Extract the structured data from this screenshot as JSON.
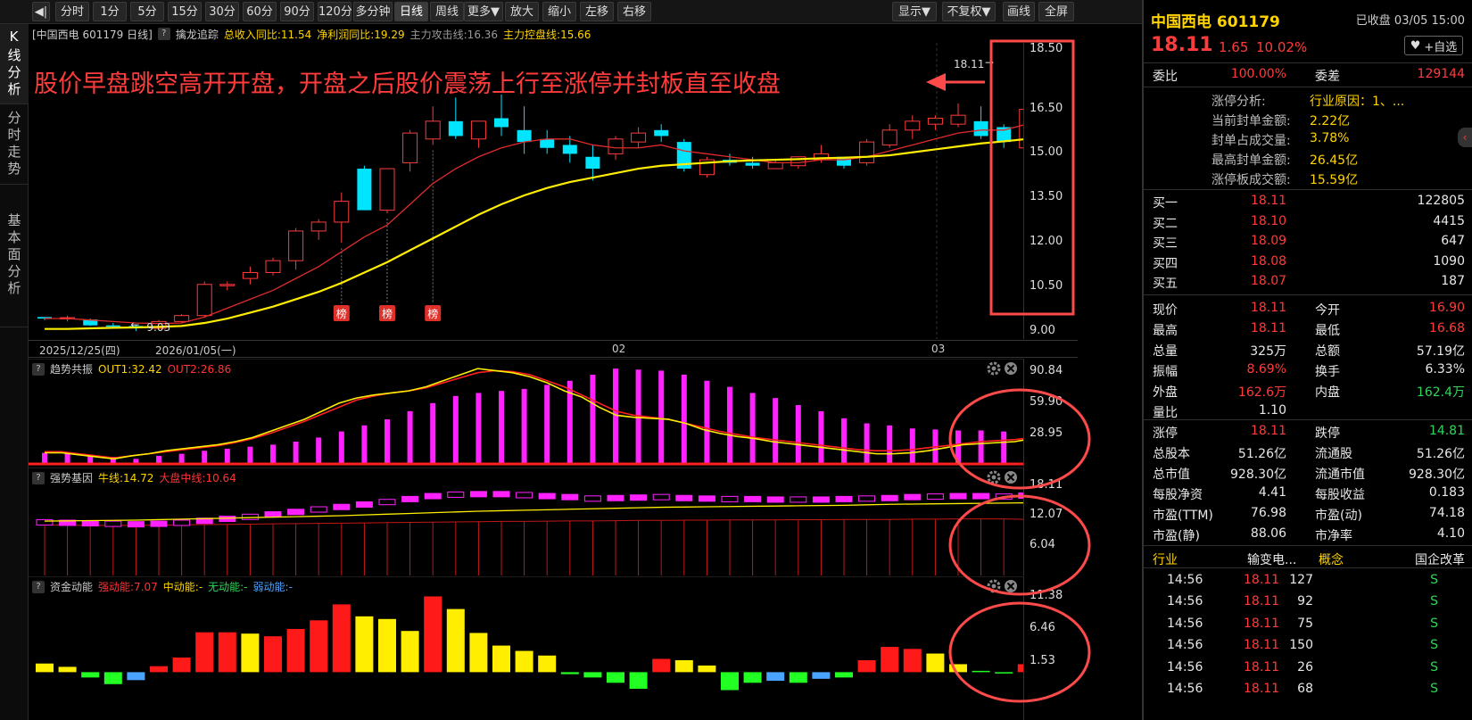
{
  "toolbar": {
    "buttons": [
      "◀|",
      "分时",
      "1分",
      "5分",
      "15分",
      "30分",
      "60分",
      "90分",
      "120分",
      "多分钟",
      "日线",
      "周线",
      "更多▼",
      "放大",
      "缩小",
      "左移",
      "右移"
    ],
    "active": "日线",
    "right_buttons": [
      "显示▼",
      "不复权▼",
      "画线",
      "全屏"
    ]
  },
  "leftnav": {
    "tabs": [
      "K线分析",
      "分时走势",
      "基本面分析"
    ]
  },
  "main_header": {
    "title": "[中国西电 601179 日线]",
    "indicator": "擒龙追踪",
    "items": [
      {
        "text": "总收入同比:11.54",
        "color": "#ffd400"
      },
      {
        "text": "净利润同比:19.29",
        "color": "#ffd400"
      },
      {
        "text": "主力攻击线:16.36",
        "color": "#9a9a9a"
      },
      {
        "text": "主力控盘线:15.66",
        "color": "#ffd400"
      }
    ]
  },
  "annotation": {
    "text": "股价早盘跳空高开开盘，开盘之后股价震荡上行至涨停并封板直至收盘",
    "last_price_label": "18.11",
    "low_label": "9.03",
    "bang_label": "榜"
  },
  "price_axis": [
    "18.50",
    "16.50",
    "15.00",
    "13.50",
    "12.00",
    "10.50",
    "9.00"
  ],
  "dates": [
    "2025/12/25(四)",
    "2026/01/05(一)",
    "02",
    "03"
  ],
  "ind1": {
    "name": "趋势共振",
    "items": [
      {
        "text": "OUT1:32.42",
        "color": "#ffd400"
      },
      {
        "text": "OUT2:26.86",
        "color": "#ff3333"
      }
    ],
    "axis": [
      "90.84",
      "59.90",
      "28.95"
    ]
  },
  "ind2": {
    "name": "强势基因",
    "items": [
      {
        "text": "牛线:14.72",
        "color": "#ffd400"
      },
      {
        "text": "大盘中线:10.64",
        "color": "#ff3333"
      }
    ],
    "axis": [
      "18.11",
      "12.07",
      "6.04"
    ]
  },
  "ind3": {
    "name": "资金动能",
    "items": [
      {
        "text": "强动能:7.07",
        "color": "#ff3333"
      },
      {
        "text": "中动能:-",
        "color": "#ffd400"
      },
      {
        "text": "无动能:-",
        "color": "#2fd65a"
      },
      {
        "text": "弱动能:-",
        "color": "#4aa3ff"
      }
    ],
    "axis": [
      "11.38",
      "6.46",
      "1.53"
    ]
  },
  "chart_data": {
    "type": "candlestick",
    "dates_shown": [
      "2025/12/25(四)",
      "2026/01/05(一)",
      "02",
      "03"
    ],
    "ohlc": [
      [
        9.5,
        9.5,
        9.4,
        9.45
      ],
      [
        9.45,
        9.55,
        9.35,
        9.48
      ],
      [
        9.42,
        9.45,
        9.2,
        9.22
      ],
      [
        9.22,
        9.3,
        9.13,
        9.2
      ],
      [
        9.2,
        9.25,
        9.03,
        9.12
      ],
      [
        9.12,
        9.4,
        9.1,
        9.35
      ],
      [
        9.35,
        9.6,
        9.3,
        9.55
      ],
      [
        9.55,
        10.7,
        9.5,
        10.6
      ],
      [
        10.6,
        10.7,
        10.4,
        10.6
      ],
      [
        10.8,
        11.2,
        10.6,
        11.0
      ],
      [
        11.0,
        11.5,
        10.9,
        11.4
      ],
      [
        11.4,
        12.5,
        11.1,
        12.4
      ],
      [
        12.4,
        12.8,
        12.1,
        12.7
      ],
      [
        12.7,
        13.7,
        12.0,
        13.4
      ],
      [
        14.5,
        14.6,
        13.1,
        13.1
      ],
      [
        13.1,
        14.5,
        13.0,
        14.5
      ],
      [
        14.7,
        15.8,
        14.4,
        15.7
      ],
      [
        15.5,
        16.6,
        15.3,
        16.1
      ],
      [
        16.1,
        16.9,
        15.5,
        15.6
      ],
      [
        15.5,
        16.0,
        15.2,
        16.1
      ],
      [
        16.2,
        17.0,
        15.6,
        15.9
      ],
      [
        15.8,
        16.6,
        15.0,
        15.4
      ],
      [
        15.5,
        15.8,
        15.0,
        15.2
      ],
      [
        15.3,
        15.6,
        14.7,
        15.0
      ],
      [
        14.9,
        15.3,
        14.1,
        14.5
      ],
      [
        15.0,
        15.6,
        14.8,
        15.5
      ],
      [
        15.4,
        15.9,
        15.2,
        15.7
      ],
      [
        15.8,
        16.0,
        15.4,
        15.6
      ],
      [
        15.4,
        15.5,
        14.4,
        14.5
      ],
      [
        14.3,
        14.9,
        14.2,
        14.8
      ],
      [
        14.8,
        15.0,
        14.6,
        14.7
      ],
      [
        14.7,
        14.9,
        14.5,
        14.6
      ],
      [
        14.5,
        14.8,
        14.5,
        14.7
      ],
      [
        14.6,
        14.8,
        14.5,
        14.9
      ],
      [
        14.8,
        15.3,
        14.7,
        15.0
      ],
      [
        14.9,
        14.9,
        14.5,
        14.6
      ],
      [
        14.7,
        15.5,
        14.6,
        15.4
      ],
      [
        15.3,
        16.0,
        15.2,
        15.8
      ],
      [
        15.8,
        16.3,
        15.5,
        16.1
      ],
      [
        16.0,
        16.3,
        15.8,
        16.2
      ],
      [
        16.0,
        16.7,
        15.9,
        16.3
      ],
      [
        16.1,
        16.6,
        15.5,
        15.6
      ],
      [
        15.9,
        16.0,
        15.2,
        15.4
      ],
      [
        15.2,
        16.5,
        15.2,
        16.5
      ],
      [
        16.9,
        18.11,
        16.68,
        18.11
      ]
    ],
    "ma_red": [
      9.45,
      9.45,
      9.4,
      9.35,
      9.3,
      9.28,
      9.3,
      9.5,
      9.8,
      10.1,
      10.4,
      10.8,
      11.2,
      11.7,
      12.2,
      12.6,
      13.3,
      14.0,
      14.5,
      14.9,
      15.2,
      15.4,
      15.5,
      15.5,
      15.3,
      15.2,
      15.2,
      15.3,
      15.1,
      15.0,
      14.9,
      14.8,
      14.7,
      14.7,
      14.8,
      14.8,
      14.9,
      15.1,
      15.3,
      15.5,
      15.7,
      15.8,
      15.8,
      16.0,
      16.36
    ],
    "ma_yellow": [
      9.1,
      9.1,
      9.12,
      9.14,
      9.15,
      9.17,
      9.2,
      9.3,
      9.45,
      9.65,
      9.85,
      10.1,
      10.35,
      10.65,
      11.0,
      11.35,
      11.75,
      12.15,
      12.55,
      12.95,
      13.3,
      13.6,
      13.85,
      14.05,
      14.2,
      14.35,
      14.5,
      14.6,
      14.65,
      14.7,
      14.75,
      14.78,
      14.8,
      14.82,
      14.85,
      14.87,
      14.9,
      14.95,
      15.05,
      15.15,
      15.25,
      15.35,
      15.42,
      15.5,
      15.66
    ],
    "ylim": [
      9.0,
      18.5
    ],
    "indicator1": {
      "ylim": [
        0,
        95
      ],
      "bars": [
        11,
        11,
        9,
        7,
        5,
        8,
        10,
        13,
        15,
        17,
        19,
        22,
        26,
        32,
        38,
        44,
        52,
        60,
        67,
        70,
        72,
        74,
        78,
        82,
        88,
        94,
        93,
        92,
        88,
        82,
        76,
        70,
        65,
        58,
        52,
        45,
        40,
        38,
        35,
        34,
        33,
        33,
        32,
        32,
        30
      ],
      "out1": [
        11,
        11,
        9,
        7,
        5,
        8,
        10,
        13,
        15,
        17,
        19,
        22,
        26,
        32,
        38,
        44,
        52,
        60,
        65,
        68,
        70,
        72,
        76,
        82,
        88,
        94,
        92,
        90,
        86,
        80,
        72,
        66,
        56,
        48,
        46,
        45,
        44,
        40,
        34,
        30,
        27,
        25,
        22,
        20,
        18,
        16,
        14,
        12,
        10,
        10,
        11,
        13,
        16,
        19,
        20,
        21,
        22,
        25,
        32.42
      ],
      "out2": [
        12,
        12,
        10,
        8,
        6,
        8,
        10,
        12,
        14,
        16,
        18,
        21,
        25,
        30,
        36,
        42,
        49,
        56,
        63,
        67,
        70,
        72,
        75,
        80,
        85,
        90,
        92,
        91,
        88,
        82,
        76,
        68,
        60,
        52,
        48,
        46,
        44,
        40,
        36,
        32,
        29,
        26,
        24,
        22,
        20,
        18,
        16,
        14,
        13,
        13,
        14,
        16,
        18,
        20,
        22,
        23,
        24,
        26,
        26.86
      ]
    },
    "indicator2": {
      "ylim": [
        0,
        19.5
      ],
      "bars": [
        11.3,
        11.2,
        11.1,
        11.0,
        10.9,
        11.0,
        11.2,
        11.6,
        12.0,
        12.4,
        12.9,
        13.4,
        13.9,
        14.4,
        14.9,
        15.4,
        16.0,
        16.6,
        16.9,
        17.0,
        17.0,
        16.8,
        16.6,
        16.4,
        16.1,
        16.2,
        16.3,
        16.4,
        16.2,
        16.1,
        16.0,
        16.0,
        15.9,
        15.9,
        15.9,
        16.0,
        16.1,
        16.2,
        16.4,
        16.5,
        16.6,
        16.6,
        16.5,
        16.7,
        18.11
      ],
      "bull": [
        11.0,
        11.05,
        11.1,
        11.15,
        11.2,
        11.3,
        11.4,
        11.5,
        11.6,
        11.7,
        11.8,
        11.9,
        12.0,
        12.1,
        12.25,
        12.4,
        12.55,
        12.7,
        12.85,
        13.0,
        13.1,
        13.2,
        13.3,
        13.4,
        13.5,
        13.6,
        13.7,
        13.8,
        13.85,
        13.9,
        13.95,
        14.0,
        14.05,
        14.1,
        14.15,
        14.2,
        14.3,
        14.4,
        14.45,
        14.5,
        14.55,
        14.6,
        14.65,
        14.7,
        14.72
      ],
      "mid": [
        10.6,
        10.55,
        10.5,
        10.5,
        10.5,
        10.55,
        10.6,
        10.65,
        10.7,
        10.75,
        10.8,
        10.85,
        10.9,
        10.95,
        11.0,
        11.05,
        11.1,
        11.15,
        11.2,
        11.25,
        11.3,
        11.3,
        11.35,
        11.4,
        11.4,
        11.45,
        11.5,
        11.5,
        11.55,
        11.55,
        11.6,
        11.6,
        11.6,
        11.65,
        11.65,
        11.7,
        11.7,
        11.7,
        11.75,
        11.75,
        11.8,
        11.8,
        11.8,
        11.7,
        10.64
      ]
    },
    "indicator3": {
      "ylim": [
        -2.5,
        12
      ],
      "values": [
        1.3,
        0.8,
        -0.8,
        -1.8,
        -1.2,
        0.9,
        2.2,
        6.0,
        6.0,
        5.8,
        5.4,
        6.5,
        7.8,
        10.2,
        8.4,
        8.0,
        6.2,
        11.4,
        9.5,
        5.9,
        4.0,
        3.2,
        2.5,
        -0.3,
        -0.8,
        -1.6,
        -2.5,
        2.0,
        1.8,
        1.0,
        -2.7,
        -1.6,
        -1.3,
        -1.6,
        -1.0,
        -0.8,
        1.8,
        3.8,
        3.5,
        2.8,
        1.2,
        0.2,
        -0.1,
        1.2,
        7.07
      ],
      "colors": [
        "yellow",
        "yellow",
        "green",
        "green",
        "blue",
        "red",
        "red",
        "red",
        "red",
        "yellow",
        "red",
        "red",
        "red",
        "red",
        "yellow",
        "yellow",
        "yellow",
        "red",
        "yellow",
        "yellow",
        "yellow",
        "yellow",
        "yellow",
        "green",
        "green",
        "green",
        "green",
        "red",
        "yellow",
        "yellow",
        "green",
        "green",
        "blue",
        "green",
        "blue",
        "green",
        "red",
        "red",
        "red",
        "yellow",
        "yellow",
        "green",
        "green",
        "red",
        "red"
      ]
    }
  },
  "rpanel": {
    "stock": "中国西电 601179",
    "status": "已收盘 03/05 15:00",
    "price": "18.11",
    "change": "1.65",
    "pct": "10.02%",
    "watch": "+自选",
    "webi_label": "委比",
    "webi": "100.00%",
    "weicha_label": "委差",
    "weicha": "129144",
    "limit": [
      {
        "label": "涨停分析:",
        "value": "行业原因：1、..."
      },
      {
        "label": "当前封单金额:",
        "value": "2.22亿"
      },
      {
        "label": "封单占成交量:",
        "value": "3.78%"
      },
      {
        "label": "最高封单金额:",
        "value": "26.45亿"
      },
      {
        "label": "涨停板成交额:",
        "value": "15.59亿"
      }
    ],
    "bids": [
      {
        "label": "买一",
        "price": "18.11",
        "vol": "122805"
      },
      {
        "label": "买二",
        "price": "18.10",
        "vol": "4415"
      },
      {
        "label": "买三",
        "price": "18.09",
        "vol": "647"
      },
      {
        "label": "买四",
        "price": "18.08",
        "vol": "1090"
      },
      {
        "label": "买五",
        "price": "18.07",
        "vol": "187"
      }
    ],
    "stats": [
      [
        {
          "l": "现价",
          "v": "18.11",
          "c": "red"
        },
        {
          "l": "今开",
          "v": "16.90",
          "c": "red"
        }
      ],
      [
        {
          "l": "最高",
          "v": "18.11",
          "c": "red"
        },
        {
          "l": "最低",
          "v": "16.68",
          "c": "red"
        }
      ],
      [
        {
          "l": "总量",
          "v": "325万",
          "c": "white"
        },
        {
          "l": "总额",
          "v": "57.19亿",
          "c": "white"
        }
      ],
      [
        {
          "l": "振幅",
          "v": "8.69%",
          "c": "red"
        },
        {
          "l": "换手",
          "v": "6.33%",
          "c": "white"
        }
      ],
      [
        {
          "l": "外盘",
          "v": "162.6万",
          "c": "red"
        },
        {
          "l": "内盘",
          "v": "162.4万",
          "c": "green"
        }
      ],
      [
        {
          "l": "量比",
          "v": "1.10",
          "c": "white"
        },
        {
          "l": "",
          "v": "",
          "c": "white"
        }
      ],
      [
        {
          "l": "涨停",
          "v": "18.11",
          "c": "red"
        },
        {
          "l": "跌停",
          "v": "14.81",
          "c": "green"
        }
      ],
      [
        {
          "l": "总股本",
          "v": "51.26亿",
          "c": "white"
        },
        {
          "l": "流通股",
          "v": "51.26亿",
          "c": "white"
        }
      ],
      [
        {
          "l": "总市值",
          "v": "928.30亿",
          "c": "white"
        },
        {
          "l": "流通市值",
          "v": "928.30亿",
          "c": "white"
        }
      ],
      [
        {
          "l": "每股净资",
          "v": "4.41",
          "c": "white"
        },
        {
          "l": "每股收益",
          "v": "0.183",
          "c": "white"
        }
      ],
      [
        {
          "l": "市盈(TTM)",
          "v": "76.98",
          "c": "white"
        },
        {
          "l": "市盈(动)",
          "v": "74.18",
          "c": "white"
        }
      ],
      [
        {
          "l": "市盈(静)",
          "v": "88.06",
          "c": "white"
        },
        {
          "l": "市净率",
          "v": "4.10",
          "c": "white"
        }
      ]
    ],
    "industry_label": "行业",
    "industry": "输变电...",
    "concept_label": "概念",
    "concept": "国企改革",
    "ticks": [
      {
        "t": "14:56",
        "p": "18.11",
        "v": "127",
        "d": "S"
      },
      {
        "t": "14:56",
        "p": "18.11",
        "v": "92",
        "d": "S"
      },
      {
        "t": "14:56",
        "p": "18.11",
        "v": "75",
        "d": "S"
      },
      {
        "t": "14:56",
        "p": "18.11",
        "v": "150",
        "d": "S"
      },
      {
        "t": "14:56",
        "p": "18.11",
        "v": "26",
        "d": "S"
      },
      {
        "t": "14:56",
        "p": "18.11",
        "v": "68",
        "d": "S"
      }
    ]
  }
}
